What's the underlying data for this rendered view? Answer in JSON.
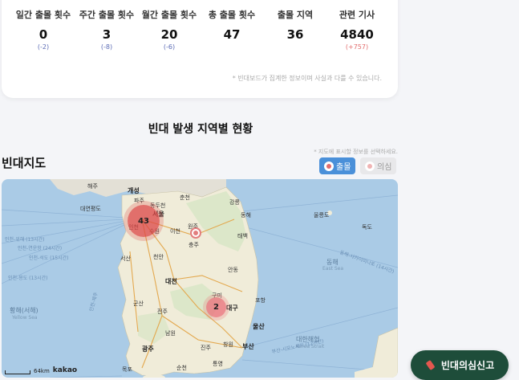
{
  "stats": [
    {
      "label": "일간 출몰 횟수",
      "value": "0",
      "delta": "(-2)",
      "delta_color": "#5b6bb5"
    },
    {
      "label": "주간 출몰 횟수",
      "value": "3",
      "delta": "(-8)",
      "delta_color": "#5b6bb5"
    },
    {
      "label": "월간 출몰 횟수",
      "value": "20",
      "delta": "(-6)",
      "delta_color": "#5b6bb5"
    },
    {
      "label": "총 출몰 횟수",
      "value": "47",
      "delta": "",
      "delta_color": "#5b6bb5"
    },
    {
      "label": "출몰 지역",
      "value": "36",
      "delta": "",
      "delta_color": "#5b6bb5"
    },
    {
      "label": "관련 기사",
      "value": "4840",
      "delta": "(+757)",
      "delta_color": "#e26d6d"
    }
  ],
  "disclaimer": "* 빈대보드가 집계한 정보이며 사실과 다를 수 있습니다.",
  "section_title": "빈대 발생 지역별 현황",
  "map_section": {
    "title": "빈대지도",
    "hint": "* 지도에 표시할 정보를 선택하세요.",
    "filters": {
      "sighting": "출몰",
      "suspect": "의심"
    }
  },
  "map": {
    "clusters": {
      "seoul": "43",
      "daegu": "2"
    },
    "labels": {
      "haeju": "해주",
      "kaesong": "개성",
      "paju": "파주",
      "dongducheon": "동두천",
      "chuncheon": "춘천",
      "gangneung": "강릉",
      "daeyeondo": "대연평도",
      "seoul": "서울",
      "incheon": "인천",
      "suwon": "수원",
      "icheon": "이천",
      "wonju": "원주",
      "donghae": "동해",
      "ulleungdo": "울릉도",
      "dokdo": "독도",
      "taebaek": "태백",
      "chungju": "충주",
      "seosan": "서산",
      "cheonan": "천안",
      "andong": "안동",
      "daejeon": "대전",
      "gunsan": "군산",
      "jeonju": "전주",
      "gumi": "구미",
      "daegu": "대구",
      "pohang": "포항",
      "ulsan": "울산",
      "namwon": "남원",
      "jinju": "진주",
      "changwon": "창원",
      "busan": "부산",
      "gwangju": "광주",
      "tongyeong": "통영",
      "suncheon": "순천",
      "mokpo": "목포"
    },
    "seas": {
      "yellow_ko": "황해(서해)",
      "yellow_en": "Yellow Sea",
      "east_ko": "동해",
      "east_en": "East Sea",
      "korea_ko": "대한해협",
      "korea_en": "Korea Strait"
    },
    "routes": {
      "r1": "인천-위해 (13시간)",
      "r2": "인천-연운항 (24시간)",
      "r3": "인천-석도 (15시간)",
      "r4": "인천-용도 (13시간)",
      "r5": "동해-사카이미나토 (14시간)",
      "r6": "부산-시모노세키 (12시간)",
      "r7": "인천-제주"
    },
    "scale_label": "64km",
    "attribution": "kakao"
  },
  "report_button": "빈대의심신고"
}
